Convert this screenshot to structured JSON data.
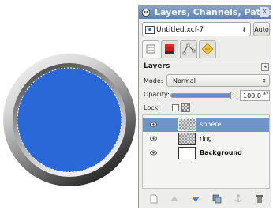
{
  "dock": {
    "title": "Layers, Channels, Paths, U",
    "close_glyph": "×",
    "image_menu": {
      "value": "Untitled.xcf-7",
      "arrow": "⬍"
    },
    "auto_button": "Auto",
    "tabs": [
      {
        "icon": "layers-tab-icon",
        "active": true
      },
      {
        "icon": "channels-tab-icon",
        "active": false
      },
      {
        "icon": "paths-tab-icon",
        "active": false
      },
      {
        "icon": "undo-history-tab-icon",
        "active": false
      }
    ],
    "panel_title": "Layers",
    "panel_menu_glyph": "◂",
    "mode_label": "Mode:",
    "mode_value": "Normal",
    "mode_arrow": "⬍",
    "opacity_label": "Opacity:",
    "opacity_value": "100,0",
    "opacity_fraction": 1.0,
    "spin_arrows": "▲▼",
    "lock_label": "Lock:",
    "layers": [
      {
        "name": "sphere",
        "visible": true,
        "selected": true
      },
      {
        "name": "ring",
        "visible": true,
        "selected": false
      },
      {
        "name": "Background",
        "visible": true,
        "selected": false,
        "bold": true
      }
    ],
    "bottom_buttons": [
      "new-layer-icon",
      "raise-layer-icon",
      "lower-layer-icon",
      "duplicate-layer-icon",
      "anchor-layer-icon",
      "delete-layer-icon"
    ]
  },
  "canvas": {
    "sphere_color": "#2a68d8",
    "ring_color_light": "#f2f2f2",
    "ring_color_dark": "#555555"
  }
}
